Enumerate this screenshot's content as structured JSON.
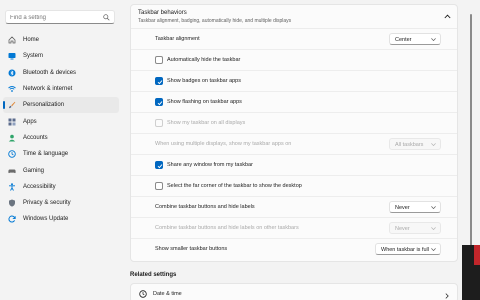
{
  "search": {
    "placeholder": "Find a setting"
  },
  "sidebar": {
    "items": [
      {
        "label": "Home",
        "icon": "home-icon",
        "color": "#5f5f5f"
      },
      {
        "label": "System",
        "icon": "system-icon",
        "color": "#0078d4"
      },
      {
        "label": "Bluetooth & devices",
        "icon": "bluetooth-icon",
        "color": "#0078d4"
      },
      {
        "label": "Network & internet",
        "icon": "wifi-icon",
        "color": "#0078d4"
      },
      {
        "label": "Personalization",
        "icon": "brush-icon",
        "color": "#e08a3c",
        "active": true
      },
      {
        "label": "Apps",
        "icon": "apps-icon",
        "color": "#5b6b8c"
      },
      {
        "label": "Accounts",
        "icon": "accounts-icon",
        "color": "#2fa46a"
      },
      {
        "label": "Time & language",
        "icon": "globe-clock-icon",
        "color": "#0078d4"
      },
      {
        "label": "Gaming",
        "icon": "gamepad-icon",
        "color": "#6b6b6b"
      },
      {
        "label": "Accessibility",
        "icon": "accessibility-icon",
        "color": "#0078d4"
      },
      {
        "label": "Privacy & security",
        "icon": "shield-icon",
        "color": "#6b7480"
      },
      {
        "label": "Windows Update",
        "icon": "update-icon",
        "color": "#0078d4"
      }
    ]
  },
  "section": {
    "title": "Taskbar behaviors",
    "subtitle": "Taskbar alignment, badging, automatically hide, and multiple displays"
  },
  "rows": [
    {
      "type": "dropdown",
      "label": "Taskbar alignment",
      "value": "Center",
      "disabled": false
    },
    {
      "type": "checkbox",
      "label": "Automatically hide the taskbar",
      "checked": false,
      "disabled": false
    },
    {
      "type": "checkbox",
      "label": "Show badges on taskbar apps",
      "checked": true,
      "disabled": false
    },
    {
      "type": "checkbox",
      "label": "Show flashing on taskbar apps",
      "checked": true,
      "disabled": false
    },
    {
      "type": "checkbox",
      "label": "Show my taskbar on all displays",
      "checked": false,
      "disabled": true
    },
    {
      "type": "dropdown",
      "label": "When using multiple displays, show my taskbar apps on",
      "value": "All taskbars",
      "disabled": true
    },
    {
      "type": "checkbox",
      "label": "Share any window from my taskbar",
      "checked": true,
      "disabled": false
    },
    {
      "type": "checkbox",
      "label": "Select the far corner of the taskbar to show the desktop",
      "checked": false,
      "disabled": false
    },
    {
      "type": "dropdown",
      "label": "Combine taskbar buttons and hide labels",
      "value": "Never",
      "disabled": false
    },
    {
      "type": "dropdown",
      "label": "Combine taskbar buttons and hide labels on other taskbars",
      "value": "Never",
      "disabled": true
    },
    {
      "type": "dropdown",
      "label": "Show smaller taskbar buttons",
      "value": "When taskbar is full",
      "disabled": false
    }
  ],
  "related": {
    "heading": "Related settings",
    "items": [
      {
        "label": "Date & time",
        "icon": "clock-icon"
      }
    ]
  },
  "colors": {
    "accent": "#0067c0"
  }
}
